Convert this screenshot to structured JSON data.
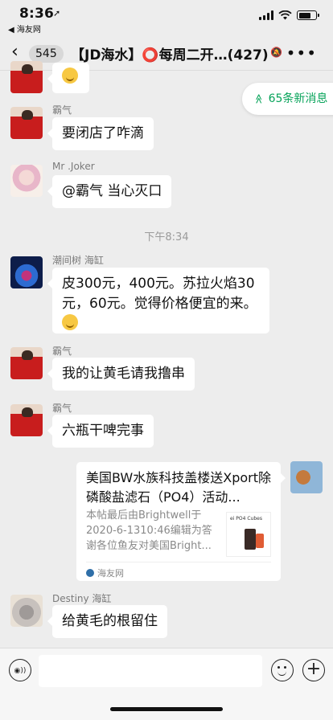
{
  "status": {
    "time": "8:36",
    "location_glyph": "➚",
    "back_app": "◀ 海友网"
  },
  "nav": {
    "back_glyph": "‹",
    "unread_count": "545",
    "title": "【JD海水】⭕每周二开…(427)",
    "mute_glyph": "🔕",
    "more_glyph": "•••"
  },
  "new_messages": {
    "arrow": "≫",
    "label": "65条新消息"
  },
  "messages": [
    {
      "sender": "",
      "text": "😂"
    },
    {
      "sender": "霸气",
      "text": "要闭店了咋滴"
    },
    {
      "sender": "Mr .Joker",
      "text": "@霸气 当心灭口"
    },
    {
      "sender": "潮间树 海缸",
      "text": "皮300元，400元。苏拉火焰30元，60元。觉得价格便宜的来。"
    },
    {
      "sender": "霸气",
      "text": "我的让黄毛请我撸串"
    },
    {
      "sender": "霸气",
      "text": "六瓶干啤完事"
    },
    {
      "sender": "Destiny 海缸",
      "text": "给黄毛的根留住"
    }
  ],
  "timestamp": "下午8:34",
  "link_card": {
    "title": "美国BW水族科技盖楼送Xport除磷酸盐滤石（PO4）活动...",
    "description": "本帖最后由Brightwell于2020-6-1310:46编辑为答谢各位鱼友对美国Bright...",
    "thumb_text": "ei PO4 Cubes",
    "source": "海友网"
  },
  "input": {
    "voice_glyph": "◉))",
    "plus_glyph": "+"
  },
  "colors": {
    "accent_green": "#07a35a",
    "bg": "#ededed"
  }
}
